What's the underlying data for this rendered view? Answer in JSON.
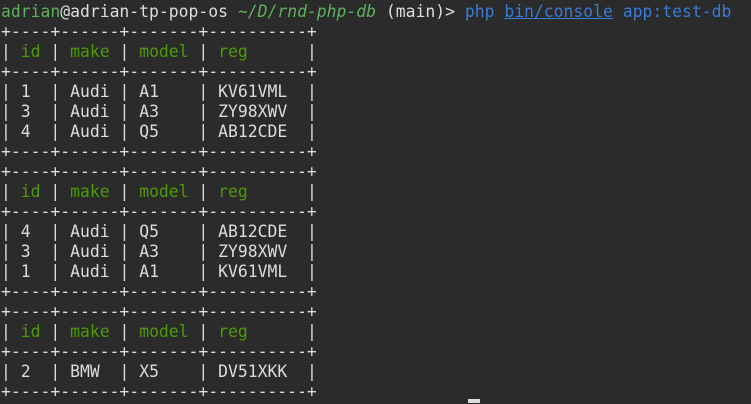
{
  "prompt": {
    "user": "adrian",
    "at": "@",
    "host": "adrian-tp-pop-os",
    "path": "~/D/rnd-php-db",
    "branch": "(main)>",
    "command": "php",
    "arg1": "bin/console",
    "arg2": "app:test-db"
  },
  "border": "+----+------+-------+----------+",
  "headers": [
    "id",
    "make",
    "model",
    "reg"
  ],
  "tables": [
    {
      "rows": [
        [
          "1",
          "Audi",
          "A1",
          "KV61VML"
        ],
        [
          "3",
          "Audi",
          "A3",
          "ZY98XWV"
        ],
        [
          "4",
          "Audi",
          "Q5",
          "AB12CDE"
        ]
      ]
    },
    {
      "rows": [
        [
          "4",
          "Audi",
          "Q5",
          "AB12CDE"
        ],
        [
          "3",
          "Audi",
          "A3",
          "ZY98XWV"
        ],
        [
          "1",
          "Audi",
          "A1",
          "KV61VML"
        ]
      ]
    },
    {
      "rows": [
        [
          "2",
          "BMW",
          "X5",
          "DV51XKK"
        ]
      ]
    }
  ]
}
